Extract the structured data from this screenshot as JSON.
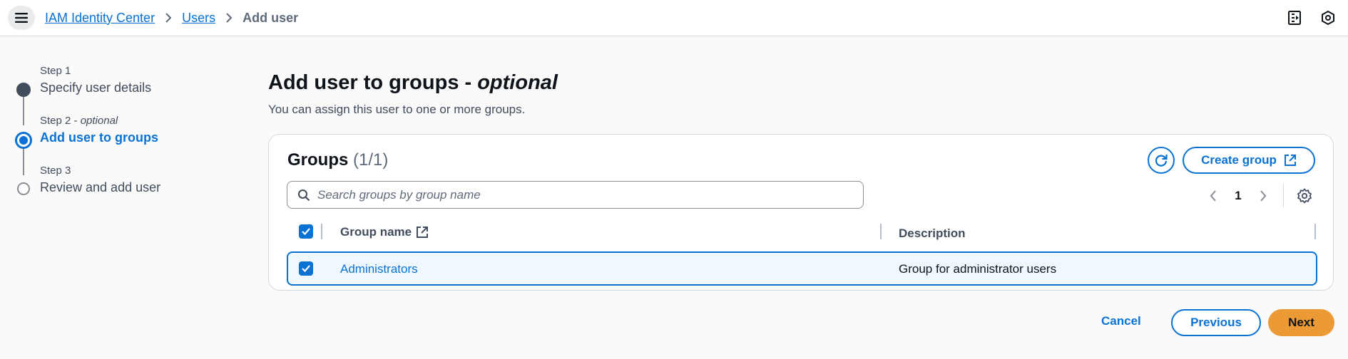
{
  "header": {
    "menu_icon": "hamburger-menu-icon",
    "breadcrumb": [
      {
        "label": "IAM Identity Center"
      },
      {
        "label": "Users"
      },
      {
        "label": "Add user"
      }
    ],
    "right_icons": [
      "notes-icon",
      "settings-hex-icon"
    ]
  },
  "steps": [
    {
      "small": "Step 1",
      "small_opt": "",
      "label": "Specify user details",
      "state": "done"
    },
    {
      "small": "Step 2 - ",
      "small_opt": "optional",
      "label": "Add user to groups",
      "state": "active"
    },
    {
      "small": "Step 3",
      "small_opt": "",
      "label": "Review and add user",
      "state": "todo"
    }
  ],
  "page": {
    "title": "Add user to groups - ",
    "title_optional": "optional",
    "description": "You can assign this user to one or more groups."
  },
  "groups": {
    "title": "Groups",
    "count": "(1/1)",
    "create_label": "Create group",
    "search_placeholder": "Search groups by group name",
    "page_number": "1",
    "columns": {
      "name": "Group name",
      "description": "Description"
    },
    "rows": [
      {
        "name": "Administrators",
        "description": "Group for administrator users",
        "checked": true
      }
    ]
  },
  "footer": {
    "cancel_label": "Cancel",
    "previous_label": "Previous",
    "next_label": "Next"
  },
  "colors": {
    "accent": "#0972d3",
    "primary_button": "#ec9a35",
    "selected_row_bg": "#f0f8ff"
  }
}
